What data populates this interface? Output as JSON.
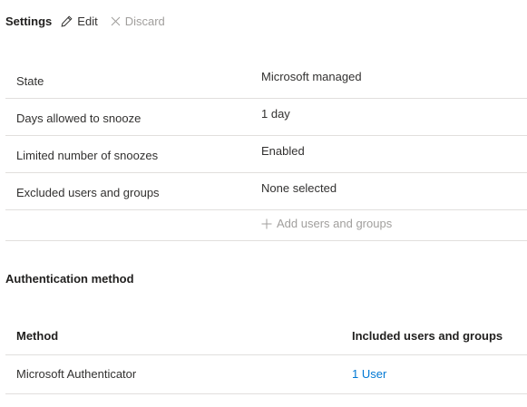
{
  "header": {
    "title": "Settings",
    "edit_label": "Edit",
    "discard_label": "Discard",
    "edit_icon": "pencil-icon",
    "discard_icon": "close-icon"
  },
  "settings": {
    "rows": [
      {
        "label": "State",
        "value": "Microsoft managed"
      },
      {
        "label": "Days allowed to snooze",
        "value": "1 day"
      },
      {
        "label": "Limited number of snoozes",
        "value": "Enabled"
      },
      {
        "label": "Excluded users and groups",
        "value": "None selected"
      }
    ],
    "add_label": "Add users and groups",
    "add_icon": "plus-icon"
  },
  "auth": {
    "title": "Authentication method",
    "columns": [
      "Method",
      "Included users and groups"
    ],
    "rows": [
      {
        "method": "Microsoft Authenticator",
        "included": "1 User"
      }
    ]
  },
  "colors": {
    "text": "#323130",
    "disabled": "#a19f9d",
    "link": "#0078d4",
    "divider": "#e1dfdd"
  }
}
